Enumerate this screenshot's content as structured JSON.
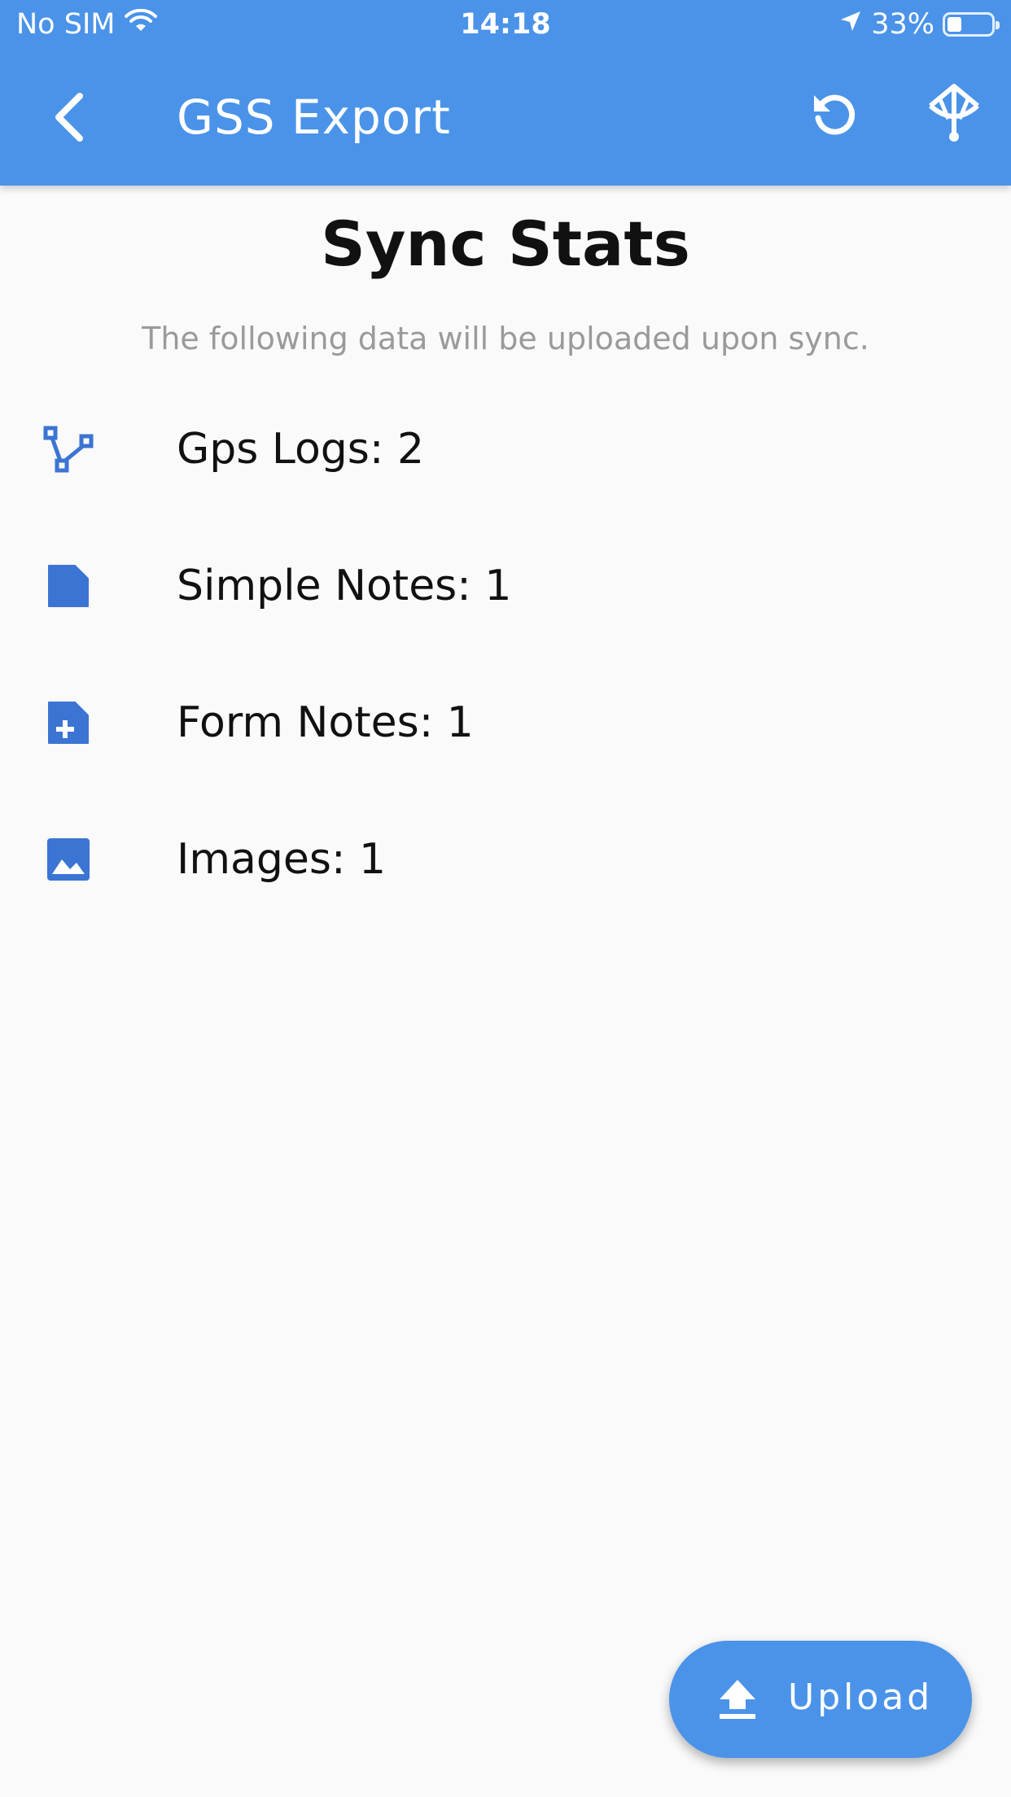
{
  "status_bar": {
    "carrier": "No SIM",
    "time": "14:18",
    "battery_percent": "33%",
    "battery_level": 0.33
  },
  "app_bar": {
    "title": "GSS Export",
    "background_color": "#4a93e9",
    "icons": [
      "back-arrow-icon",
      "refresh-icon",
      "gss-server-icon"
    ]
  },
  "main": {
    "title": "Sync Stats",
    "subtitle": "The following data will be uploaded upon sync.",
    "stats": [
      {
        "icon": "gps-log-icon",
        "label": "Gps Logs: 2"
      },
      {
        "icon": "note-icon",
        "label": "Simple Notes: 1"
      },
      {
        "icon": "form-note-icon",
        "label": "Form Notes: 1"
      },
      {
        "icon": "image-icon",
        "label": "Images: 1"
      }
    ],
    "icon_color": "#3b74d3"
  },
  "fab": {
    "label": "Upload",
    "icon": "upload-icon"
  }
}
